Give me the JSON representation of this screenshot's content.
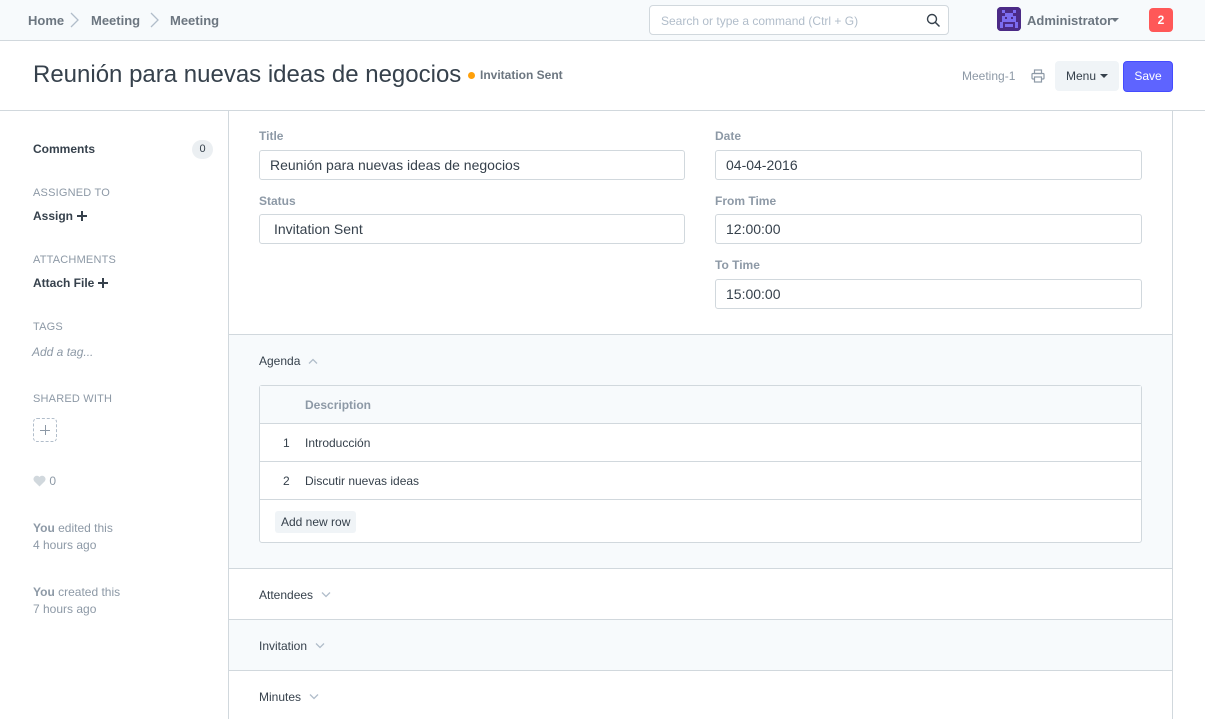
{
  "navbar": {
    "breadcrumbs": [
      "Home",
      "Meeting",
      "Meeting"
    ],
    "search_placeholder": "Search or type a command (Ctrl + G)",
    "user_name": "Administrator",
    "notification_count": "2"
  },
  "page_head": {
    "title": "Reunión para nuevas ideas de negocios",
    "status": "Invitation Sent",
    "doc_name": "Meeting-1",
    "menu_label": "Menu",
    "save_label": "Save"
  },
  "sidebar": {
    "comments_label": "Comments",
    "comments_count": "0",
    "assigned_to_label": "ASSIGNED TO",
    "assign_label": "Assign",
    "attachments_label": "ATTACHMENTS",
    "attach_file_label": "Attach File",
    "tags_label": "TAGS",
    "add_tag_placeholder": "Add a tag...",
    "shared_with_label": "SHARED WITH",
    "likes_count": "0",
    "timeline": [
      {
        "who": "You",
        "action": " edited this",
        "when": "4 hours ago"
      },
      {
        "who": "You",
        "action": " created this",
        "when": "7 hours ago"
      }
    ]
  },
  "form": {
    "title_label": "Title",
    "title_value": "Reunión para nuevas ideas de negocios",
    "status_label": "Status",
    "status_value": "Invitation Sent",
    "date_label": "Date",
    "date_value": "04-04-2016",
    "from_time_label": "From Time",
    "from_time_value": "12:00:00",
    "to_time_label": "To Time",
    "to_time_value": "15:00:00"
  },
  "agenda": {
    "section_label": "Agenda",
    "column_header": "Description",
    "rows": [
      {
        "idx": "1",
        "description": "Introducción"
      },
      {
        "idx": "2",
        "description": "Discutir nuevas ideas"
      }
    ],
    "add_row_label": "Add new row"
  },
  "sections": {
    "attendees": "Attendees",
    "invitation": "Invitation",
    "minutes": "Minutes"
  },
  "colors": {
    "primary": "#5e64ff",
    "status_orange": "#ffa00a",
    "notification_red": "#ff5858"
  }
}
